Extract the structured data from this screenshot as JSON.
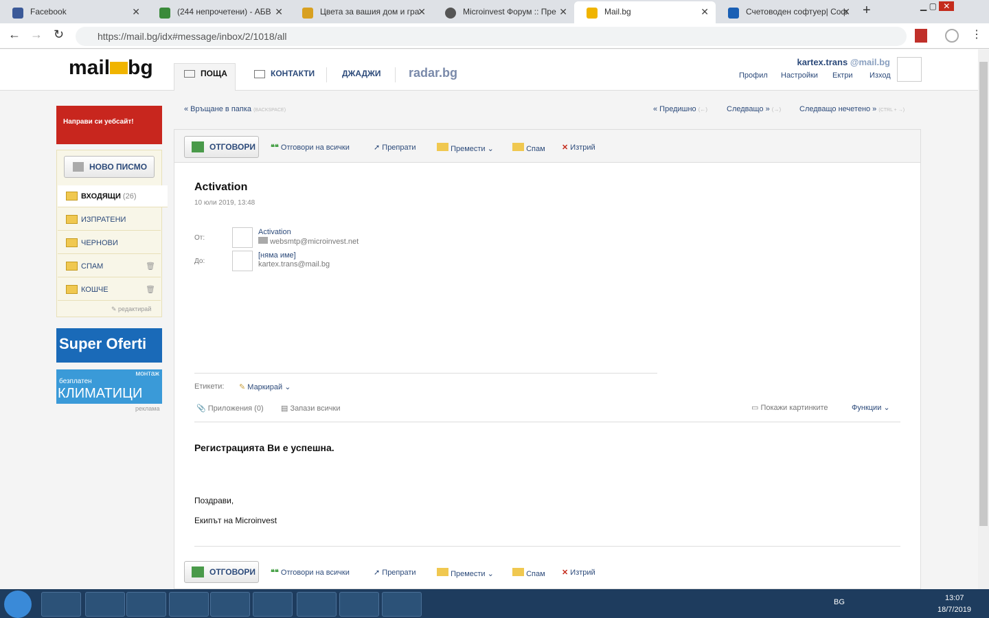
{
  "tabs": [
    {
      "label": "Facebook",
      "color": "#3b5998"
    },
    {
      "label": "(244 непрочетени) - АБВ",
      "color": "#3a8a3a"
    },
    {
      "label": "Цвета за вашия дом и гра",
      "color": "#d8a020"
    },
    {
      "label": "Microinvest Форум :: Пре",
      "color": "#555555"
    },
    {
      "label": "Mail.bg",
      "color": "#f0b400"
    },
    {
      "label": "Счетоводен софтуер| Соф",
      "color": "#1a5fb4"
    }
  ],
  "url": "https://mail.bg/idx#message/inbox/2/1018/all",
  "brand": {
    "left": "mail",
    "right": "bg"
  },
  "nav": [
    "ПОЩА",
    "КОНТАКТИ",
    "ДЖАДЖИ",
    "radar.bg"
  ],
  "user": {
    "name": "kartex.trans",
    "domain": "@mail.bg",
    "links": [
      "Профил",
      "Настройки",
      "Ектри",
      "Изход"
    ]
  },
  "ad_top": "Направи си уебсайт!",
  "new_mail": "НОВО ПИСМО",
  "folders": [
    {
      "label": "ВХОДЯЩИ",
      "count": "(26)"
    },
    {
      "label": "ИЗПРАТЕНИ"
    },
    {
      "label": "ЧЕРНОВИ"
    },
    {
      "label": "СПАМ"
    },
    {
      "label": "КОШЧЕ"
    }
  ],
  "edit": "редактирай",
  "ad2": "Super Oferti",
  "ad3": "КЛИМАТИЦИ",
  "ad3b": "безплатен",
  "ad3c": "монтаж",
  "ad_label": "реклама",
  "back": "« Връщане в папка",
  "back_hint": "(BACKSPACE)",
  "pager": {
    "prev": "« Предишно",
    "prev_hint": "(←)",
    "next": "Следващо »",
    "next_hint": "(→)",
    "unread": "Следващо нечетено »",
    "unread_hint": "(CTRL + →)"
  },
  "toolbar": {
    "reply": "ОТГОВОРИ",
    "reply_all": "Отговори на всички",
    "forward": "Препрати",
    "move": "Премести",
    "spam": "Спам",
    "delete": "Изтрий"
  },
  "msg": {
    "subject": "Activation",
    "date": "10 юли 2019, 13:48",
    "from_label": "От:",
    "from_name": "Activation",
    "from_email": "websmtp@microinvest.net",
    "to_label": "До:",
    "to_name": "[няма име]",
    "to_email": "kartex.trans@mail.bg",
    "labels_label": "Етикети:",
    "mark": "Маркирай",
    "attachments": "Приложения (0)",
    "save_all": "Запази всички",
    "show_images": "Покажи картинките",
    "functions": "Функции",
    "body_title": "Регистрацията Ви е успешна.",
    "body_l1": "Поздрави,",
    "body_l2": "Екипът на Microinvest"
  },
  "tray": {
    "lang": "BG",
    "time": "13:07",
    "date": "18/7/2019"
  }
}
